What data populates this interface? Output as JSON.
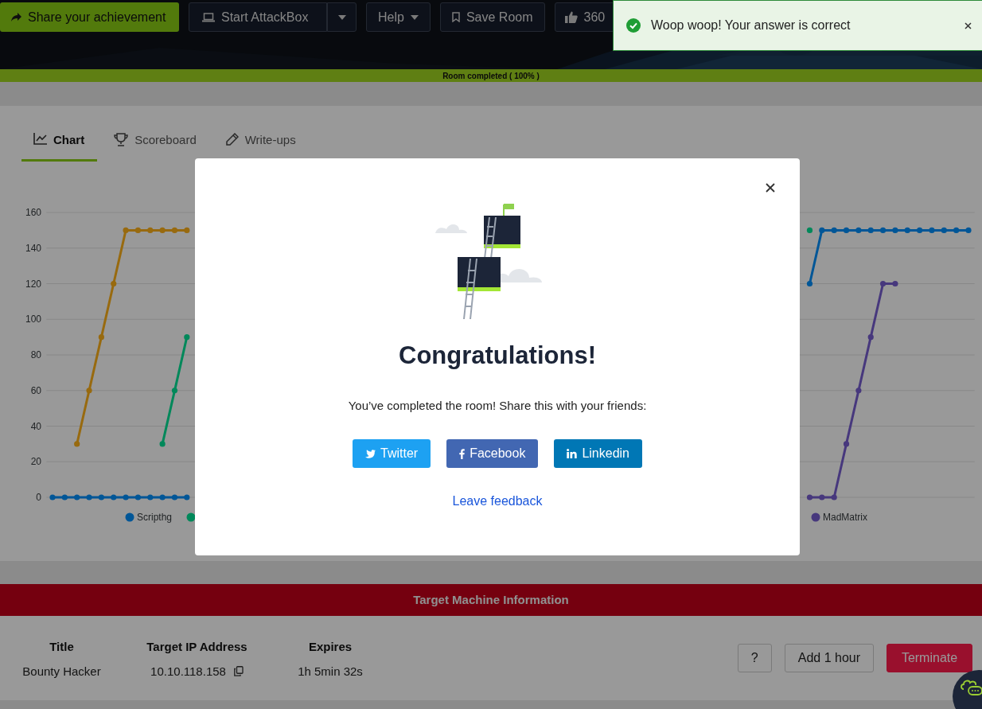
{
  "top_bar": {
    "buttons": [
      {
        "label": "Share your achievement",
        "kind": "share"
      },
      {
        "label": "Start AttackBox",
        "kind": "attackbox"
      },
      {
        "label": "Help",
        "kind": "help"
      },
      {
        "label": "Save Room",
        "kind": "save"
      },
      {
        "label": "360",
        "kind": "like"
      }
    ]
  },
  "progress": {
    "label": "Room completed ( 100% )",
    "level": 1
  },
  "tabs": [
    {
      "label": "Chart",
      "kind": "chart",
      "selected": true
    },
    {
      "label": "Scoreboard",
      "kind": "scoreboard",
      "selected": false
    },
    {
      "label": "Write-ups",
      "kind": "writeups",
      "selected": false
    }
  ],
  "chart": {
    "chart_data": {
      "type": "line",
      "ylim": [
        0,
        160
      ],
      "yticks": [
        0,
        20,
        40,
        60,
        80,
        100,
        120,
        140,
        160
      ],
      "grid": true,
      "legend": true,
      "series": [
        {
          "name": "Scripthg",
          "color": "#005697",
          "marker": true,
          "values": [
            0,
            0,
            0,
            0,
            0,
            0,
            0,
            0,
            0,
            0,
            0,
            0,
            null,
            null,
            null,
            null,
            null,
            null,
            null,
            null,
            null,
            null,
            null,
            null,
            null,
            null,
            null,
            null,
            null,
            null,
            null,
            null,
            null,
            null,
            null,
            null,
            null,
            null,
            null,
            null,
            null,
            null,
            null,
            null,
            null,
            null,
            null,
            null,
            null,
            null,
            null,
            null,
            null,
            null,
            null,
            null,
            null,
            null,
            null,
            null,
            null,
            null,
            120,
            150,
            150,
            150,
            150,
            150,
            150,
            150,
            150,
            150,
            150,
            150,
            150,
            150
          ]
        },
        {
          "color": "#00885a",
          "marker": true,
          "values": [
            null,
            null,
            null,
            null,
            null,
            null,
            null,
            null,
            null,
            30,
            60,
            90,
            null,
            null,
            null,
            null,
            null,
            null,
            null,
            null,
            null,
            null,
            null,
            null,
            null,
            null,
            null,
            null,
            null,
            null,
            null,
            null,
            null,
            null,
            null,
            null,
            null,
            null,
            null,
            null,
            null,
            null,
            null,
            null,
            null,
            null,
            null,
            null,
            null,
            null,
            null,
            null,
            null,
            null,
            null,
            null,
            null,
            null,
            null,
            null,
            null,
            null,
            150,
            null,
            null,
            null,
            null,
            null,
            null,
            null,
            null,
            null,
            null,
            null,
            null,
            null
          ]
        },
        {
          "color": "#986a0f",
          "marker": true,
          "values": [
            null,
            null,
            30,
            60,
            90,
            120,
            150,
            150,
            150,
            150,
            150,
            150,
            null,
            null,
            null,
            null,
            null,
            null,
            null,
            null,
            null,
            null,
            null,
            null,
            null,
            null,
            null,
            null,
            null,
            null,
            null,
            null,
            null,
            null,
            null,
            null,
            null,
            null,
            null,
            null,
            null,
            null,
            null,
            null,
            null,
            null,
            null,
            null,
            null,
            null,
            null,
            null,
            null,
            null,
            null,
            null,
            null,
            null,
            null,
            null,
            null,
            null,
            null,
            null,
            null,
            null,
            null,
            null,
            null,
            null,
            null,
            null,
            null,
            null,
            null,
            null
          ]
        },
        {
          "name": "MadMatrix",
          "color": "#47387d",
          "marker": true,
          "values": [
            null,
            null,
            null,
            null,
            null,
            null,
            null,
            null,
            null,
            null,
            null,
            null,
            null,
            null,
            null,
            null,
            null,
            null,
            null,
            null,
            null,
            null,
            null,
            null,
            null,
            null,
            null,
            null,
            null,
            null,
            null,
            null,
            null,
            null,
            null,
            null,
            null,
            null,
            null,
            null,
            null,
            null,
            null,
            null,
            null,
            null,
            null,
            null,
            null,
            null,
            null,
            null,
            null,
            null,
            null,
            null,
            null,
            null,
            null,
            null,
            null,
            null,
            0,
            0,
            0,
            30,
            60,
            90,
            120,
            120,
            null,
            null,
            null,
            null,
            null,
            null
          ]
        }
      ]
    }
  },
  "machine_info": {
    "title": "Target Machine Information",
    "columns": [
      {
        "heading": "Title",
        "value": "Bounty Hacker",
        "copy": false
      },
      {
        "heading": "Target IP Address",
        "value": "10.10.118.158",
        "copy": true
      },
      {
        "heading": "Expires",
        "value": "1h 5min 32s",
        "copy": false
      }
    ],
    "buttons": [
      {
        "label": "?",
        "kind": "help"
      },
      {
        "label": "Add 1 hour",
        "kind": "extend"
      },
      {
        "label": "Terminate",
        "kind": "danger"
      }
    ]
  },
  "modal": {
    "title": "Congratulations!",
    "message": "You’ve completed the room! Share this with your friends:",
    "share_buttons": [
      {
        "label": "Twitter",
        "kind": "twitter"
      },
      {
        "label": "Facebook",
        "kind": "facebook"
      },
      {
        "label": "Linkedin",
        "kind": "linkedin"
      }
    ],
    "link": "Leave feedback"
  },
  "toast": {
    "message": "Woop woop! Your answer is correct",
    "kind": "success"
  }
}
